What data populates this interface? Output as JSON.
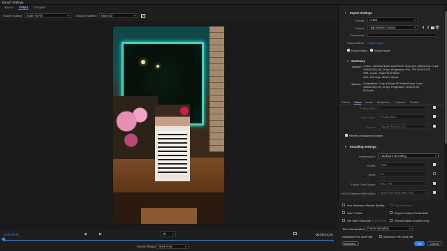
{
  "window": {
    "title": "Export Settings"
  },
  "tabs": [
    "Source",
    "Output",
    "Compare"
  ],
  "active_tab": "Output",
  "source_row": {
    "scaling_label": "Source Scaling:",
    "scaling_value": "Scale To Fill",
    "rotation_label": "Source Rotation:",
    "rotation_value": "None (0)"
  },
  "timeline": {
    "timecode_start": "00;00;00;00",
    "timecode_end": "00;00;01;20",
    "fit_value": "Fit",
    "source_range_label": "Source Range:",
    "source_range_value": "Work Area",
    "progress": 0
  },
  "export": {
    "section": "Export Settings",
    "format_label": "Format:",
    "format_value": "H.264",
    "preset_label": "Preset:",
    "preset_value": "High Bitrate Custom",
    "comments_label": "Comments:",
    "output_name_label": "Output Name:",
    "output_name_value": "Comp 1.mp4",
    "export_video": "Export Video",
    "export_audio": "Export Audio"
  },
  "summary": {
    "title": "Summary",
    "output_label": "Output:",
    "output_text": "C:\\Use...ntU\\Dow flower shop\\Flower shop.mp4_AMO\\Comp 1.mp4\n1080x1920 (1.0), 30 fps, Progressive, Rec. 709, 00:00:01:20\nVBR, 1 pass, Target 45.00 Mbps\nAAC, 320 Kbps, 48 kHz, Stereo",
    "source_label": "Source:",
    "source_text": "Composition, Comp 1/Adobe AE Project/Comp 1.mp4\n1080x1920 (1.0), 30 fps, Progressive, 00:00:01:20\nNo Audio"
  },
  "subtabs": [
    "Effects",
    "Video",
    "Audio",
    "Multiplexer",
    "Captions",
    "Publish"
  ],
  "active_subtab": "Video",
  "video": {
    "frame_rate_label": "Frame Rate:",
    "field_order_label": "Field Order:",
    "field_order_value": "Progressive",
    "aspect_label": "Aspect:",
    "aspect_value": "Square Pixels (1.0)",
    "render_max_depth": "Render at Maximum Depth"
  },
  "encoding": {
    "section": "Encoding Settings",
    "performance_label": "Performance:",
    "performance_value": "Hardware Encoding",
    "profile_label": "Profile:",
    "profile_value": "Main",
    "level_label": "Level:",
    "level_value": "4.1",
    "color_space_label": "Export Color Space:",
    "color_space_value": "Rec. 709",
    "hdr_label": "HDR Graphics White (Nits):",
    "hdr_value": "203 (75% HLG, 58% PQ)"
  },
  "options": {
    "max_render_quality": "Use Maximum Render Quality",
    "use_previews": "Use Previews",
    "use_proxies": "Use Proxies",
    "export_content_credentials": "Export Content Credentials",
    "set_start_timecode": "Set Start Timecode",
    "start_timecode_value": "00;00;00;00",
    "render_alpha": "Render Alpha Channel Only",
    "time_interp_label": "Time Interpolation:",
    "time_interp_value": "Frame Sampling",
    "est_size_label": "Estimated File Size:",
    "est_size_value": "9 MB",
    "max_size_label": "Maximum File Size:",
    "max_size_value": "0 MB"
  },
  "buttons": {
    "metadata": "Metadata...",
    "ok": "OK",
    "cancel": "Cancel"
  },
  "colors": {
    "accent": "#2b7de8",
    "link": "#3a8ef0"
  }
}
